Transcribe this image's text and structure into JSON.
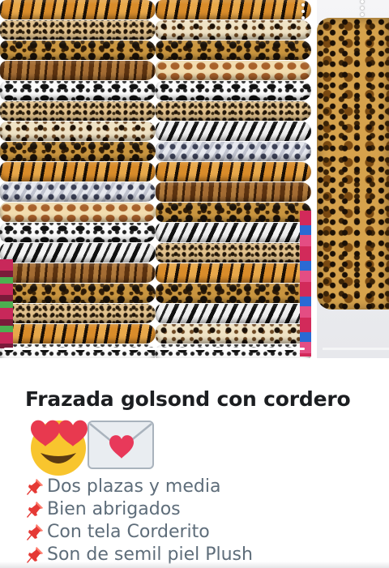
{
  "carousel": {
    "slides": [
      {
        "name": "stacked-animal-print-blankets"
      },
      {
        "name": "leopard-print-blanket-on-bed"
      }
    ],
    "current_slide_progress": 1.0
  },
  "post": {
    "title": "Frazada golsond con cordero",
    "emoji": [
      "heart-eyes",
      "love-letter"
    ],
    "bullets": [
      {
        "icon": "pushpin-icon",
        "text": "Dos plazas y media"
      },
      {
        "icon": "pushpin-icon",
        "text": "Bien abrigados"
      },
      {
        "icon": "pushpin-icon",
        "text": "Con tela Corderito"
      },
      {
        "icon": "pushpin-icon",
        "text": "Son de semil piel Plush"
      }
    ]
  },
  "colors": {
    "title": "#1c1e21",
    "bullet_text": "#5e6d7a",
    "pin": "#e53935",
    "background": "#ffffff"
  }
}
